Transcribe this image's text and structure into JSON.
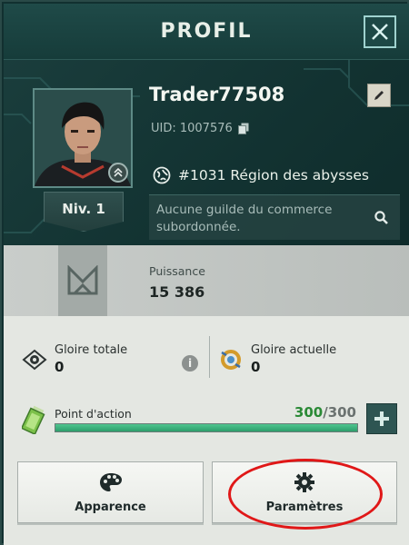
{
  "header": {
    "title": "PROFIL"
  },
  "player": {
    "name": "Trader77508",
    "uid": "UID: 1007576",
    "level": "Niv. 1",
    "region": "#1031 Région des abysses",
    "guild": "Aucune guilde du commerce subordonnée."
  },
  "power": {
    "label": "Puissance",
    "value": "15 386"
  },
  "stats": {
    "total_glory_label": "Gloire totale",
    "total_glory_value": "0",
    "current_glory_label": "Gloire actuelle",
    "current_glory_value": "0",
    "info": "i"
  },
  "action_points": {
    "label": "Point d'action",
    "current": "300",
    "separator": "/",
    "max": "300",
    "fill_fraction": 1.0
  },
  "buttons": {
    "appearance": "Apparence",
    "settings": "Paramètres"
  },
  "icons": {
    "close": "close-icon",
    "edit": "edit-icon",
    "copy": "copy-icon",
    "globe": "globe-icon",
    "search": "search-icon",
    "power": "chevron-emblem-icon",
    "glory": "eye-emblem-icon",
    "current_glory": "ring-icon",
    "energy": "battery-icon",
    "plus": "plus-icon",
    "palette": "palette-icon",
    "gear": "gear-icon"
  },
  "colors": {
    "accent_green": "#2a8a36",
    "highlight_red": "#e01818",
    "teal_dark": "#123030"
  }
}
